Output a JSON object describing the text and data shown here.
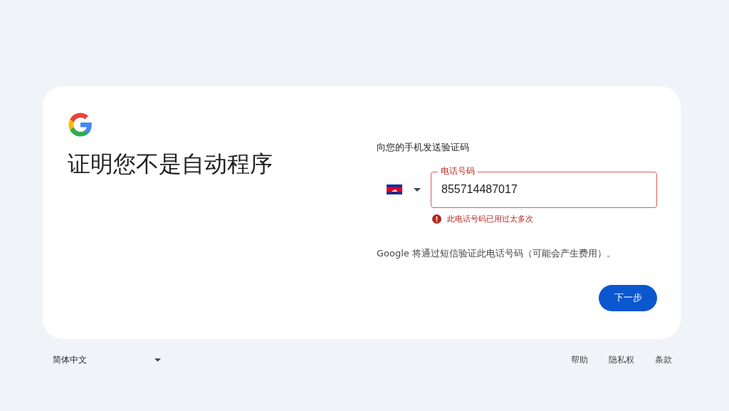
{
  "heading": "证明您不是自动程序",
  "prompt": "向您的手机发送验证码",
  "phone_field": {
    "label": "电话号码",
    "value": "855714487017",
    "error": true
  },
  "error_message": "此电话号码已用过太多次",
  "notice": "Google 将通过短信验证此电话号码（可能会产生费用）。",
  "next_button": "下一步",
  "footer": {
    "language": "简体中文",
    "links": [
      "帮助",
      "隐私权",
      "条款"
    ]
  }
}
